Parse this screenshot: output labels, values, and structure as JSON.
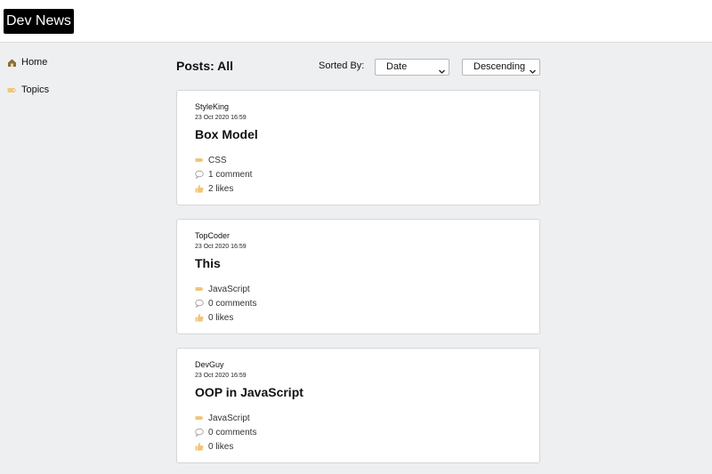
{
  "header": {
    "logo": "Dev News"
  },
  "sidebar": {
    "items": [
      {
        "label": "Home",
        "icon": "home-icon"
      },
      {
        "label": "Topics",
        "icon": "tag-icon"
      }
    ]
  },
  "main": {
    "title": "Posts: All",
    "sort_label": "Sorted By:",
    "sort_field": {
      "value": "Date"
    },
    "sort_order": {
      "value": "Descending"
    }
  },
  "posts": [
    {
      "author": "StyleKing",
      "date": "23 Oct 2020 16:59",
      "title": "Box Model",
      "topic": "CSS",
      "comments": "1 comment",
      "likes": "2 likes"
    },
    {
      "author": "TopCoder",
      "date": "23 Oct 2020 16:59",
      "title": "This",
      "topic": "JavaScript",
      "comments": "0 comments",
      "likes": "0 likes"
    },
    {
      "author": "DevGuy",
      "date": "23 Oct 2020 16:59",
      "title": "OOP in JavaScript",
      "topic": "JavaScript",
      "comments": "0 comments",
      "likes": "0 likes"
    }
  ],
  "colors": {
    "accent_icon": "#f0c67a",
    "page_bg": "#eeeff1"
  }
}
